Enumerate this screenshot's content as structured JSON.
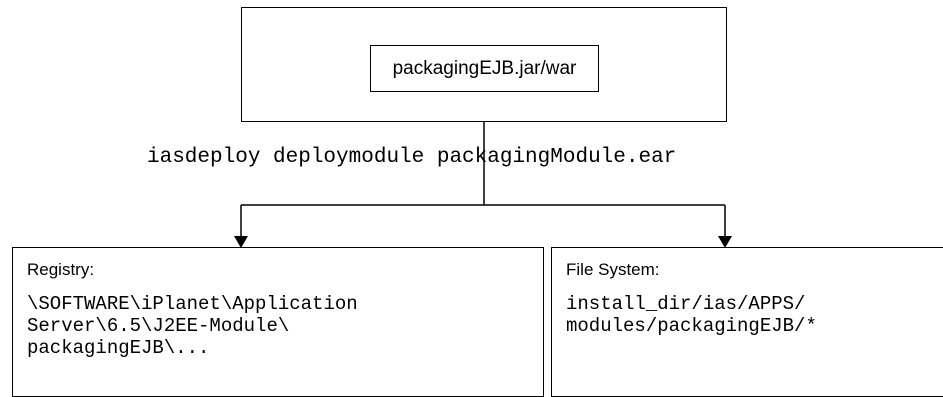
{
  "diagram": {
    "archive_label": "packagingEJB.jar/war",
    "command": "iasdeploy deploymodule packagingModule.ear",
    "registry": {
      "title": "Registry:",
      "lines": [
        "\\SOFTWARE\\iPlanet\\Application",
        "Server\\6.5\\J2EE-Module\\",
        "packagingEJB\\..."
      ]
    },
    "file_system": {
      "title": "File System:",
      "lines": [
        "install_dir/ias/APPS/",
        "modules/packagingEJB/*"
      ]
    }
  }
}
